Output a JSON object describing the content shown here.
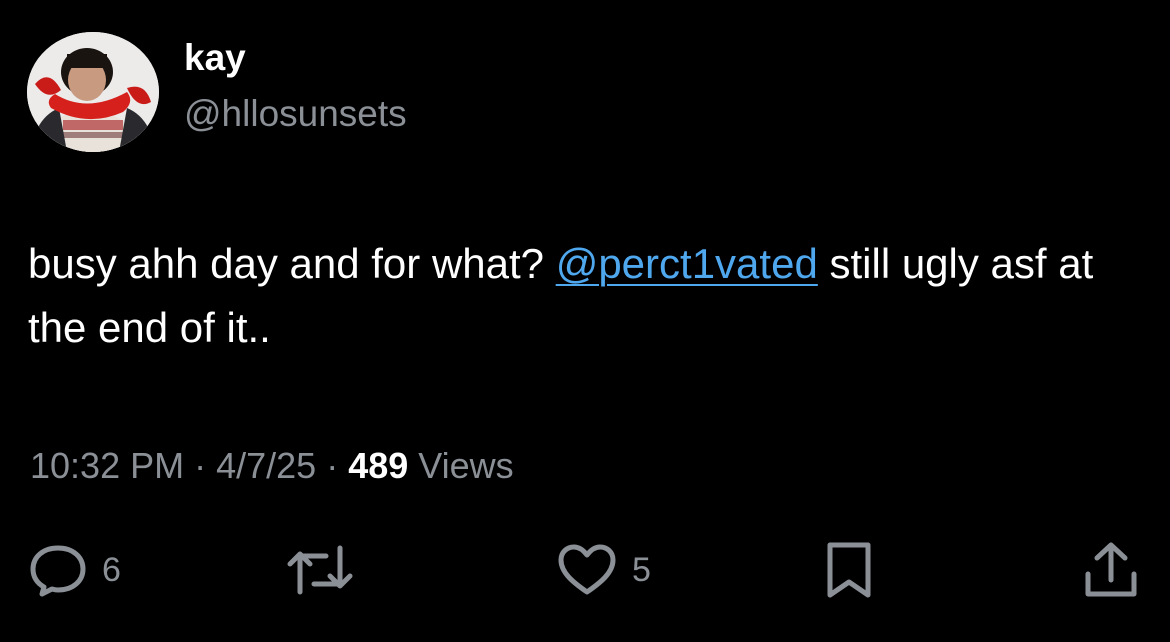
{
  "author": {
    "display_name": "kay",
    "handle": "@hllosunsets"
  },
  "tweet": {
    "text_before": "busy ahh day and for what? ",
    "mention": "@perct1vated",
    "text_after": " still ugly asf at the end of it.."
  },
  "meta": {
    "time": "10:32 PM",
    "separator": " · ",
    "date": "4/7/25",
    "views_count": "489",
    "views_label": " Views"
  },
  "actions": {
    "replies": "6",
    "likes": "5"
  },
  "icons": {
    "reply": "reply-icon",
    "retweet": "retweet-icon",
    "like": "heart-icon",
    "bookmark": "bookmark-icon",
    "share": "share-icon"
  },
  "colors": {
    "background": "#000000",
    "text": "#ffffff",
    "secondary": "#8b9097",
    "link": "#4fa7ee"
  }
}
